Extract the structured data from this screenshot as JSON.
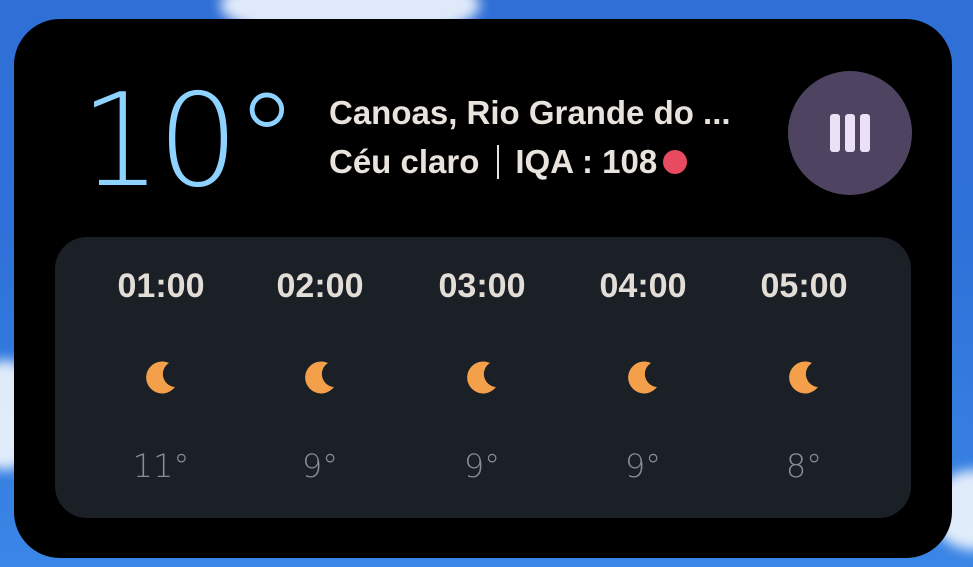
{
  "current": {
    "temperature": "10°",
    "location": "Canoas, Rio Grande do ...",
    "condition": "Céu claro",
    "aqi_label": "IQA : 108",
    "aqi_color": "#e84a5f"
  },
  "menu_button": {
    "icon": "menu-bars-icon"
  },
  "forecast": [
    {
      "hour": "01:00",
      "icon": "crescent-moon-icon",
      "temp": "11°"
    },
    {
      "hour": "02:00",
      "icon": "crescent-moon-icon",
      "temp": "9°"
    },
    {
      "hour": "03:00",
      "icon": "crescent-moon-icon",
      "temp": "9°"
    },
    {
      "hour": "04:00",
      "icon": "crescent-moon-icon",
      "temp": "9°"
    },
    {
      "hour": "05:00",
      "icon": "crescent-moon-icon",
      "temp": "8°"
    }
  ],
  "colors": {
    "accent_temp": "#8ed3ff",
    "moon": "#f4a04a",
    "menu_bg": "#4e4360"
  }
}
